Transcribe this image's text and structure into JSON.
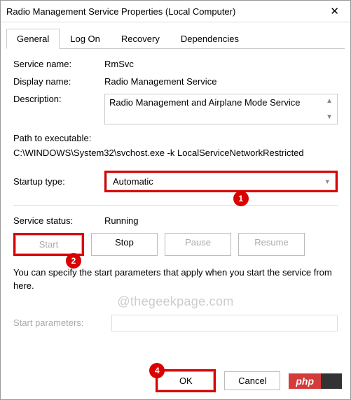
{
  "window": {
    "title": "Radio Management Service Properties (Local Computer)",
    "close": "✕"
  },
  "tabs": {
    "general": "General",
    "logon": "Log On",
    "recovery": "Recovery",
    "dependencies": "Dependencies"
  },
  "labels": {
    "service_name": "Service name:",
    "display_name": "Display name:",
    "description": "Description:",
    "path": "Path to executable:",
    "startup_type": "Startup type:",
    "service_status": "Service status:",
    "start_params": "Start parameters:"
  },
  "values": {
    "service_name": "RmSvc",
    "display_name": "Radio Management Service",
    "description": "Radio Management and Airplane Mode Service",
    "path": "C:\\WINDOWS\\System32\\svchost.exe -k LocalServiceNetworkRestricted",
    "startup_type": "Automatic",
    "service_status": "Running",
    "start_params": ""
  },
  "buttons": {
    "start": "Start",
    "stop": "Stop",
    "pause": "Pause",
    "resume": "Resume",
    "ok": "OK",
    "cancel": "Cancel"
  },
  "hint": "You can specify the start parameters that apply when you start the service from here.",
  "watermark": "@thegeekpage.com",
  "markers": {
    "m1": "1",
    "m2": "2",
    "m4": "4"
  },
  "badge": "php"
}
